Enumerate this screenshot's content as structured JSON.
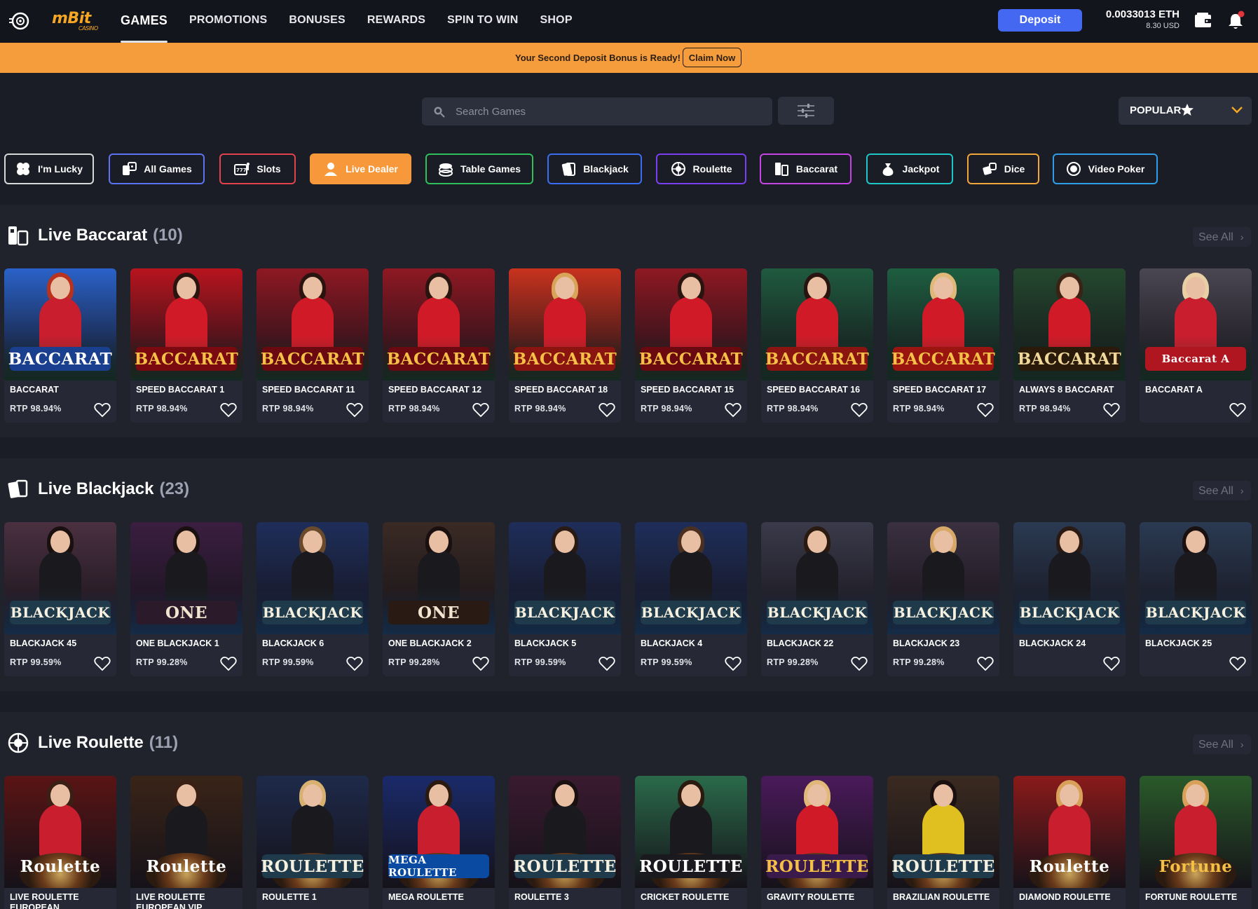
{
  "header": {
    "brand": "mBit",
    "brand_sub": "CASINO",
    "nav": [
      "GAMES",
      "PROMOTIONS",
      "BONUSES",
      "REWARDS",
      "SPIN TO WIN",
      "SHOP"
    ],
    "deposit_label": "Deposit",
    "balance_eth": "0.0033013 ETH",
    "balance_usd": "8.30 USD"
  },
  "promo": {
    "text": "Your Second Deposit Bonus is Ready!",
    "claim_label": "Claim Now"
  },
  "search": {
    "placeholder": "Search Games",
    "sort_label": "POPULAR"
  },
  "categories": [
    {
      "label": "I'm Lucky",
      "color": "#d8d8d8",
      "icon": "clover-icon"
    },
    {
      "label": "All Games",
      "color": "#5b73f0",
      "icon": "dice-cards-icon"
    },
    {
      "label": "Slots",
      "color": "#e0434b",
      "icon": "slot-machine-icon"
    },
    {
      "label": "Live Dealer",
      "color": "#f7993a",
      "icon": "live-dealer-icon",
      "active": true
    },
    {
      "label": "Table Games",
      "color": "#2fbf5a",
      "icon": "chip-stack-icon"
    },
    {
      "label": "Blackjack",
      "color": "#3a6ef0",
      "icon": "cards-icon"
    },
    {
      "label": "Roulette",
      "color": "#7b3ef0",
      "icon": "roulette-icon"
    },
    {
      "label": "Baccarat",
      "color": "#c644e6",
      "icon": "baccarat-icon"
    },
    {
      "label": "Jackpot",
      "color": "#1ec6c6",
      "icon": "money-bag-icon"
    },
    {
      "label": "Dice",
      "color": "#f0a63a",
      "icon": "dice-icon"
    },
    {
      "label": "Video Poker",
      "color": "#2e9ee8",
      "icon": "poker-chip-icon"
    }
  ],
  "sections": [
    {
      "title": "Live Baccarat",
      "count": "(10)",
      "see_all": "See All",
      "games": [
        {
          "name": "BACCARAT",
          "rtp": "RTP 98.94%",
          "banner": "BACCARAT",
          "bg": "#2a62c9",
          "banner_bg": "#1a3f8f",
          "banner_fg": "#ffffff",
          "dress": "#c81e2e",
          "hair": "#b8321d"
        },
        {
          "name": "SPEED BACCARAT 1",
          "rtp": "RTP 98.94%",
          "banner": "BACCARAT",
          "bg": "#b8141e",
          "banner_bg": "#7a0a10",
          "banner_fg": "#f5c046",
          "dress": "#d01a28",
          "hair": "#2a1410"
        },
        {
          "name": "SPEED BACCARAT 11",
          "rtp": "RTP 98.94%",
          "banner": "BACCARAT",
          "bg": "#8e1822",
          "banner_bg": "#6a0a10",
          "banner_fg": "#f5c046",
          "dress": "#d01a28",
          "hair": "#2a1410"
        },
        {
          "name": "SPEED BACCARAT 12",
          "rtp": "RTP 98.94%",
          "banner": "BACCARAT",
          "bg": "#8e1822",
          "banner_bg": "#6a0a10",
          "banner_fg": "#f5c046",
          "dress": "#d01a28",
          "hair": "#2a1410"
        },
        {
          "name": "SPEED BACCARAT 18",
          "rtp": "RTP 98.94%",
          "banner": "BACCARAT",
          "bg": "#c8321e",
          "banner_bg": "#8a1410",
          "banner_fg": "#f5c046",
          "dress": "#d01a28",
          "hair": "#d8a458"
        },
        {
          "name": "SPEED BACCARAT 15",
          "rtp": "RTP 98.94%",
          "banner": "BACCARAT",
          "bg": "#8e1822",
          "banner_bg": "#6a0a10",
          "banner_fg": "#f5c046",
          "dress": "#d01a28",
          "hair": "#2a1410"
        },
        {
          "name": "SPEED BACCARAT 16",
          "rtp": "RTP 98.94%",
          "banner": "BACCARAT",
          "bg": "#1f5a3e",
          "banner_bg": "#8a1410",
          "banner_fg": "#f5c046",
          "dress": "#d01a28",
          "hair": "#2a1410"
        },
        {
          "name": "SPEED BACCARAT 17",
          "rtp": "RTP 98.94%",
          "banner": "BACCARAT",
          "bg": "#1e5e40",
          "banner_bg": "#9a1410",
          "banner_fg": "#f5c046",
          "dress": "#d01a28",
          "hair": "#e0b878"
        },
        {
          "name": "ALWAYS 8 BACCARAT",
          "rtp": "RTP 98.94%",
          "banner": "BACCARAT",
          "bg": "#24482e",
          "banner_bg": "#2a1a0a",
          "banner_fg": "#f0d89a",
          "dress": "#d01a28",
          "hair": "#3a2214"
        },
        {
          "name": "BACCARAT A",
          "rtp": "",
          "banner": "Baccarat A",
          "bg": "#4a4652",
          "banner_bg": "#b01620",
          "banner_fg": "#ffffff",
          "dress": "#c81e2e",
          "hair": "#e8d0a4"
        }
      ]
    },
    {
      "title": "Live Blackjack",
      "count": "(23)",
      "see_all": "See All",
      "games": [
        {
          "name": "BLACKJACK 45",
          "rtp": "RTP 99.59%",
          "banner": "BLACKJACK",
          "bg": "#4a3040",
          "banner_bg": "#1f3a4a",
          "banner_fg": "#f5f0e0",
          "dress": "#1a1a1e",
          "hair": "#1a1010"
        },
        {
          "name": "ONE BLACKJACK 1",
          "rtp": "RTP 99.28%",
          "banner": "ONE",
          "bg": "#3a1e40",
          "banner_bg": "#2a1a2a",
          "banner_fg": "#f0e6d0",
          "dress": "#1a1a1e",
          "hair": "#1a1010"
        },
        {
          "name": "BLACKJACK 6",
          "rtp": "RTP 99.59%",
          "banner": "BLACKJACK",
          "bg": "#1e2e5a",
          "banner_bg": "#1f3a4a",
          "banner_fg": "#f5f0e0",
          "dress": "#1a1a1e",
          "hair": "#6a4a2a"
        },
        {
          "name": "ONE BLACKJACK 2",
          "rtp": "RTP 99.28%",
          "banner": "ONE",
          "bg": "#3a2a24",
          "banner_bg": "#2a1a14",
          "banner_fg": "#f0e6d0",
          "dress": "#1a1a1e",
          "hair": "#1a1010"
        },
        {
          "name": "BLACKJACK 5",
          "rtp": "RTP 99.59%",
          "banner": "BLACKJACK",
          "bg": "#1e2e5a",
          "banner_bg": "#1f3a4a",
          "banner_fg": "#f5f0e0",
          "dress": "#1a1a1e",
          "hair": "#2a1a14"
        },
        {
          "name": "BLACKJACK 4",
          "rtp": "RTP 99.59%",
          "banner": "BLACKJACK",
          "bg": "#1e2e5a",
          "banner_bg": "#1f3a4a",
          "banner_fg": "#f5f0e0",
          "dress": "#1a1a1e",
          "hair": "#4a3020"
        },
        {
          "name": "BLACKJACK 22",
          "rtp": "RTP 99.28%",
          "banner": "BLACKJACK",
          "bg": "#3a3a4a",
          "banner_bg": "#1f3a4a",
          "banner_fg": "#f5f0e0",
          "dress": "#1a1a1e",
          "hair": "#2a1a10"
        },
        {
          "name": "BLACKJACK 23",
          "rtp": "RTP 99.28%",
          "banner": "BLACKJACK",
          "bg": "#3a3040",
          "banner_bg": "#1f3a4a",
          "banner_fg": "#f5f0e0",
          "dress": "#1a1a1e",
          "hair": "#d8a868"
        },
        {
          "name": "BLACKJACK 24",
          "rtp": "",
          "banner": "BLACKJACK",
          "bg": "#2a3a52",
          "banner_bg": "#1f3a4a",
          "banner_fg": "#f5f0e0",
          "dress": "#1a1a1e",
          "hair": "#2a1a14"
        },
        {
          "name": "BLACKJACK 25",
          "rtp": "",
          "banner": "BLACKJACK",
          "bg": "#2a3a52",
          "banner_bg": "#1f3a4a",
          "banner_fg": "#f5f0e0",
          "dress": "#1a1a1e",
          "hair": "#1a1010"
        }
      ]
    },
    {
      "title": "Live Roulette",
      "count": "(11)",
      "see_all": "See All",
      "games": [
        {
          "name": "LIVE ROULETTE EUROPEAN",
          "rtp": "",
          "banner": "Roulette",
          "bg": "#5a1414",
          "banner_bg": "transparent",
          "banner_fg": "#ffffff",
          "dress": "#c81e2e",
          "hair": "#3a2014"
        },
        {
          "name": "LIVE ROULETTE EUROPEAN VIP",
          "rtp": "",
          "banner": "Roulette",
          "bg": "#3a2418",
          "banner_bg": "transparent",
          "banner_fg": "#ffffff",
          "dress": "#1a1a1e",
          "hair": "#3a2014"
        },
        {
          "name": "ROULETTE 1",
          "rtp": "",
          "banner": "ROULETTE",
          "bg": "#1e2a4a",
          "banner_bg": "#1f3a4a",
          "banner_fg": "#f5f0e0",
          "dress": "#1a1a1e",
          "hair": "#d8b070"
        },
        {
          "name": "MEGA ROULETTE",
          "rtp": "",
          "banner": "MEGA ROULETTE",
          "bg": "#1a2a6a",
          "banner_bg": "#0a4aa0",
          "banner_fg": "#ffffff",
          "dress": "#c81e2e",
          "hair": "#2a1a10"
        },
        {
          "name": "ROULETTE 3",
          "rtp": "",
          "banner": "ROULETTE",
          "bg": "#3a1a30",
          "banner_bg": "#1f3a4a",
          "banner_fg": "#f5f0e0",
          "dress": "#1a1a1e",
          "hair": "#1a1010"
        },
        {
          "name": "CRICKET ROULETTE",
          "rtp": "",
          "banner": "ROULETTE",
          "bg": "#2a6a4a",
          "banner_bg": "#1a1a1e",
          "banner_fg": "#ffffff",
          "dress": "#1a1a1e",
          "hair": "#2a1a10"
        },
        {
          "name": "GRAVITY ROULETTE",
          "rtp": "",
          "banner": "ROULETTE",
          "bg": "#4a1a5a",
          "banner_bg": "#3a1a4a",
          "banner_fg": "#f5c046",
          "dress": "#d01a28",
          "hair": "#e0b878"
        },
        {
          "name": "BRAZILIAN ROULETTE",
          "rtp": "",
          "banner": "ROULETTE",
          "bg": "#3a2a20",
          "banner_bg": "#1f3a4a",
          "banner_fg": "#f5f0e0",
          "dress": "#e0c020",
          "hair": "#1a1010"
        },
        {
          "name": "DIAMOND ROULETTE",
          "rtp": "",
          "banner": "Roulette",
          "bg": "#8a1a1a",
          "banner_bg": "transparent",
          "banner_fg": "#ffffff",
          "dress": "#c81e2e",
          "hair": "#d8a058"
        },
        {
          "name": "FORTUNE ROULETTE",
          "rtp": "",
          "banner": "Fortune",
          "bg": "#2a5a2a",
          "banner_bg": "transparent",
          "banner_fg": "#f5c046",
          "dress": "#c81e2e",
          "hair": "#d8a058"
        }
      ]
    }
  ]
}
